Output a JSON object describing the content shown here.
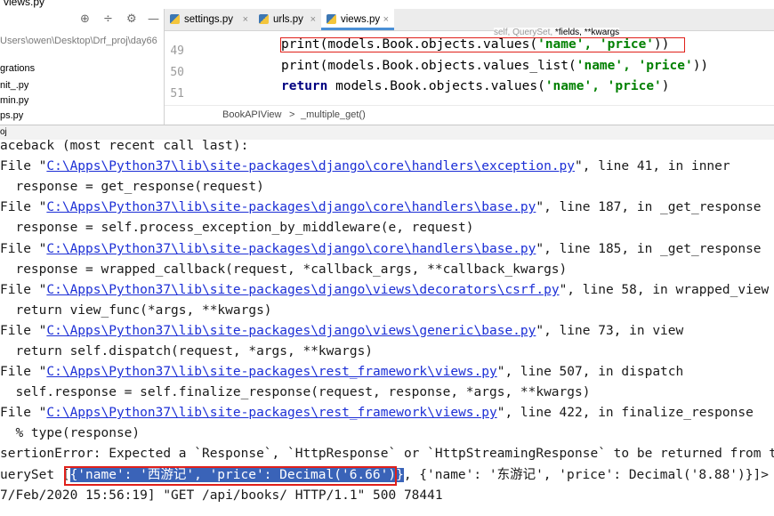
{
  "window": {
    "title": "views.py"
  },
  "project": {
    "path": "Users\\owen\\Desktop\\Drf_proj\\day66",
    "items": [
      "grations",
      "nit_.py",
      "min.py",
      "ps.py"
    ]
  },
  "tabs": [
    {
      "label": "settings.py",
      "active": false
    },
    {
      "label": "urls.py",
      "active": false
    },
    {
      "label": "views.py",
      "active": true
    }
  ],
  "editor": {
    "hint_prefix": "self, QuerySet,",
    "hint_bold": "*fields, **kwargs",
    "lines": [
      {
        "num": "49",
        "a": "print(models.Book.objects.values(",
        "b": "'name', 'price'",
        "c": "))"
      },
      {
        "num": "50",
        "a": "print(models.Book.objects.values_list(",
        "b": "'name', 'price'",
        "c": "))"
      },
      {
        "num": "51",
        "kw": "return",
        "a": " models.Book.objects.values(",
        "b": "'name', 'price'",
        "c": ")"
      }
    ],
    "breadcrumb": [
      "BookAPIView",
      ">",
      "_multiple_get()"
    ]
  },
  "console": {
    "header": "oj",
    "lines": [
      {
        "pre": "aceback (most recent call last):"
      },
      {
        "pre": "File \"",
        "link": "C:\\Apps\\Python37\\lib\\site-packages\\django\\core\\handlers\\exception.py",
        "post": "\", line 41, in inner"
      },
      {
        "pre": "  response = get_response(request)"
      },
      {
        "pre": "File \"",
        "link": "C:\\Apps\\Python37\\lib\\site-packages\\django\\core\\handlers\\base.py",
        "post": "\", line 187, in _get_response"
      },
      {
        "pre": "  response = self.process_exception_by_middleware(e, request)"
      },
      {
        "pre": "File \"",
        "link": "C:\\Apps\\Python37\\lib\\site-packages\\django\\core\\handlers\\base.py",
        "post": "\", line 185, in _get_response"
      },
      {
        "pre": "  response = wrapped_callback(request, *callback_args, **callback_kwargs)"
      },
      {
        "pre": "File \"",
        "link": "C:\\Apps\\Python37\\lib\\site-packages\\django\\views\\decorators\\csrf.py",
        "post": "\", line 58, in wrapped_view"
      },
      {
        "pre": "  return view_func(*args, **kwargs)"
      },
      {
        "pre": "File \"",
        "link": "C:\\Apps\\Python37\\lib\\site-packages\\django\\views\\generic\\base.py",
        "post": "\", line 73, in view"
      },
      {
        "pre": "  return self.dispatch(request, *args, **kwargs)"
      },
      {
        "pre": "File \"",
        "link": "C:\\Apps\\Python37\\lib\\site-packages\\rest_framework\\views.py",
        "post": "\", line 507, in dispatch"
      },
      {
        "pre": "  self.response = self.finalize_response(request, response, *args, **kwargs)"
      },
      {
        "pre": "File \"",
        "link": "C:\\Apps\\Python37\\lib\\site-packages\\rest_framework\\views.py",
        "post": "\", line 422, in finalize_response"
      },
      {
        "pre": "  % type(response)"
      },
      {
        "pre": "sertionError: Expected a `Response`, `HttpResponse` or `HttpStreamingResponse` to be returned from the"
      }
    ],
    "qs_prefix": "uerySet [",
    "qs_selected": "{'name': '西游记', 'price': Decimal('6.66')}",
    "qs_rest": ", {'name': '东游记', 'price': Decimal('8.88')}]>",
    "log_line": "7/Feb/2020 15:56:19] \"GET /api/books/ HTTP/1.1\" 500 78441"
  }
}
